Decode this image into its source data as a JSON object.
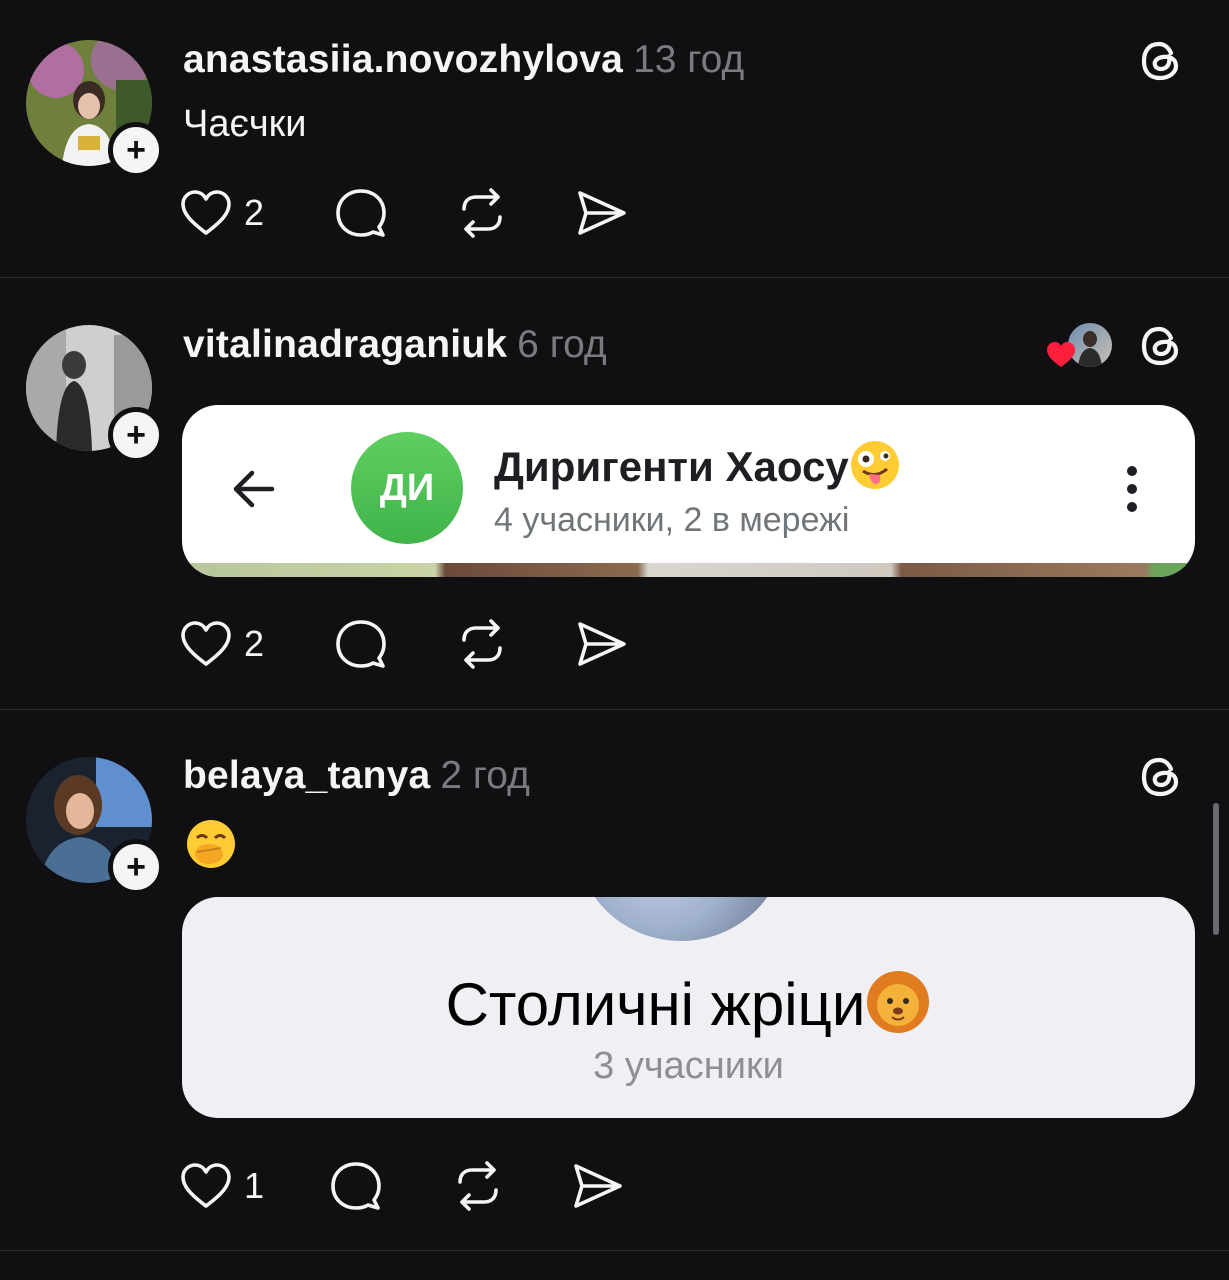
{
  "posts": [
    {
      "username": "anastasiia.novozhylova",
      "time": "13 год",
      "text": "Чаєчки",
      "likes": "2",
      "avatar_icon": "profile-photo",
      "follow_icon": "plus-icon"
    },
    {
      "username": "vitalinadraganiuk",
      "time": "6 год",
      "likes": "2",
      "liked_by_icon": "heart-liked-avatar",
      "embed": {
        "avatar_initials": "ДИ",
        "title": "Диригенти Хаосу",
        "subtitle": "4 учасники, 2 в мережі"
      }
    },
    {
      "username": "belaya_tanya",
      "time": "2 год",
      "text_emoji": "hand-over-mouth-emoji",
      "likes": "1",
      "embed": {
        "title": "Столичні жріци",
        "subtitle": "3 учасники"
      }
    }
  ],
  "icons": {
    "platform": "threads-icon",
    "like": "heart-icon",
    "reply": "comment-icon",
    "repost": "repost-icon",
    "share": "send-icon"
  },
  "colors": {
    "background": "#101012",
    "text": "#f3f5f7",
    "muted": "#7a7a7f",
    "like_heart": "#ff1f3d",
    "group_avatar": "#4cc153"
  }
}
